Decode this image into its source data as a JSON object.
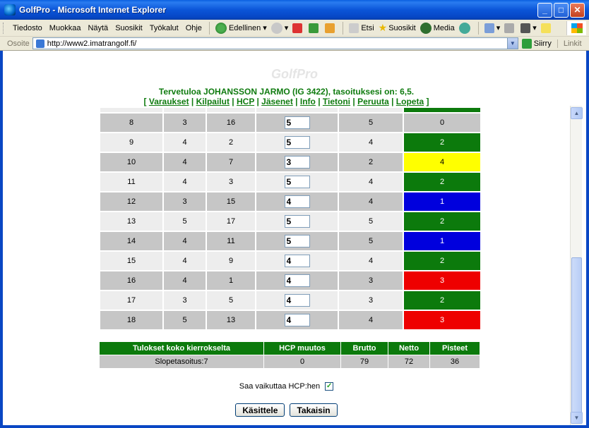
{
  "window": {
    "title": "GolfPro - Microsoft Internet Explorer"
  },
  "menu": [
    "Tiedosto",
    "Muokkaa",
    "Näytä",
    "Suosikit",
    "Työkalut",
    "Ohje"
  ],
  "toolbar": {
    "back": "Edellinen",
    "search": "Etsi",
    "favorites": "Suosikit",
    "media": "Media"
  },
  "address": {
    "label": "Osoite",
    "url": "http://www2.imatrangolf.fi/",
    "go": "Siirry",
    "links": "Linkit"
  },
  "page": {
    "logo": "GolfPro",
    "welcome": "Tervetuloa JOHANSSON JARMO (IG 3422), tasoituksesi on: 6,5.",
    "nav": [
      "Varaukset",
      "Kilpailut",
      "HCP",
      "Jäsenet",
      "Info",
      "Tietoni",
      "Peruuta",
      "Lopeta"
    ]
  },
  "holes": [
    {
      "hole": "8",
      "par": "3",
      "hcp": "16",
      "score": "5",
      "strokes": "5",
      "points": "0",
      "color": ""
    },
    {
      "hole": "9",
      "par": "4",
      "hcp": "2",
      "score": "5",
      "strokes": "4",
      "points": "2",
      "color": "green"
    },
    {
      "hole": "10",
      "par": "4",
      "hcp": "7",
      "score": "3",
      "strokes": "2",
      "points": "4",
      "color": "yellow"
    },
    {
      "hole": "11",
      "par": "4",
      "hcp": "3",
      "score": "5",
      "strokes": "4",
      "points": "2",
      "color": "green"
    },
    {
      "hole": "12",
      "par": "3",
      "hcp": "15",
      "score": "4",
      "strokes": "4",
      "points": "1",
      "color": "blue"
    },
    {
      "hole": "13",
      "par": "5",
      "hcp": "17",
      "score": "5",
      "strokes": "5",
      "points": "2",
      "color": "green"
    },
    {
      "hole": "14",
      "par": "4",
      "hcp": "11",
      "score": "5",
      "strokes": "5",
      "points": "1",
      "color": "blue"
    },
    {
      "hole": "15",
      "par": "4",
      "hcp": "9",
      "score": "4",
      "strokes": "4",
      "points": "2",
      "color": "green"
    },
    {
      "hole": "16",
      "par": "4",
      "hcp": "1",
      "score": "4",
      "strokes": "3",
      "points": "3",
      "color": "red"
    },
    {
      "hole": "17",
      "par": "3",
      "hcp": "5",
      "score": "4",
      "strokes": "3",
      "points": "2",
      "color": "green"
    },
    {
      "hole": "18",
      "par": "5",
      "hcp": "13",
      "score": "4",
      "strokes": "4",
      "points": "3",
      "color": "red"
    }
  ],
  "summary": {
    "headers": [
      "Tulokset koko kierrokselta",
      "HCP muutos",
      "Brutto",
      "Netto",
      "Pisteet"
    ],
    "row": [
      "Slopetasoitus:7",
      "0",
      "79",
      "72",
      "36"
    ]
  },
  "hcp_toggle": {
    "label": "Saa vaikuttaa HCP:hen",
    "checked": true
  },
  "buttons": {
    "process": "Käsittele",
    "back": "Takaisin"
  }
}
